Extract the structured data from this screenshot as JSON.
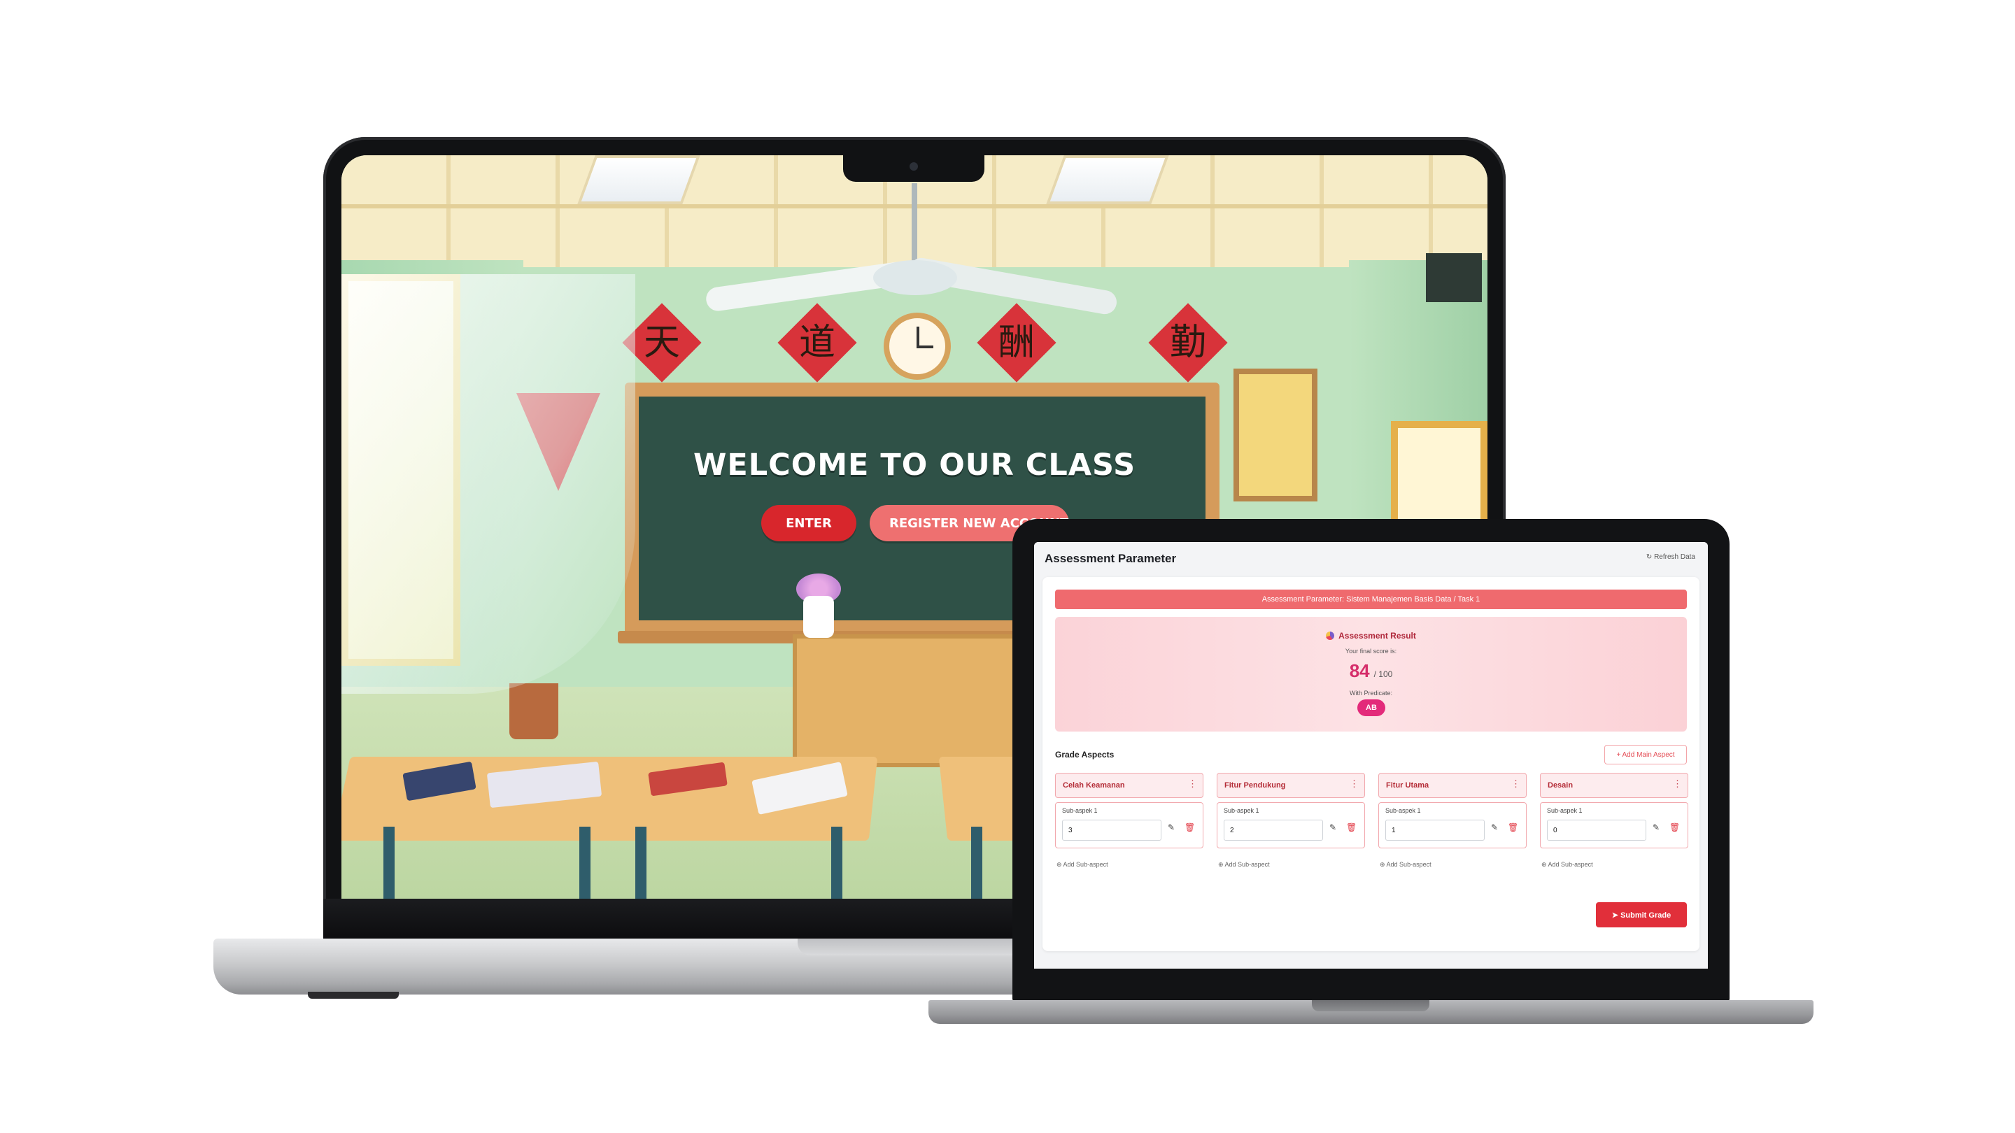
{
  "laptop_classroom": {
    "welcome_title": "WELCOME TO OUR CLASS",
    "enter_button": "ENTER",
    "register_button": "REGISTER NEW ACCOUNT",
    "chinese_chars": [
      "天",
      "道",
      "酬",
      "勤"
    ],
    "colors": {
      "enter": "#d8262c",
      "register": "#ee7070",
      "chalkboard": "#2f5147"
    }
  },
  "laptop_assessment": {
    "header": {
      "title": "Assessment Parameter",
      "refresh_label": "↻ Refresh Data"
    },
    "banner": "Assessment Parameter: Sistem Manajemen Basis Data / Task 1",
    "result": {
      "title": "Assessment Result",
      "subtitle": "Your final score is:",
      "score": "84",
      "score_max": "/ 100",
      "predicate_label": "With Predicate:",
      "predicate": "AB"
    },
    "grade_aspects": {
      "title": "Grade Aspects",
      "add_main_label": "+ Add Main Aspect",
      "aspects": [
        {
          "name": "Celah Keamanan",
          "sub_label": "Sub-aspek 1",
          "value": "3",
          "add_sub": "⊕ Add Sub-aspect"
        },
        {
          "name": "Fitur Pendukung",
          "sub_label": "Sub-aspek 1",
          "value": "2",
          "add_sub": "⊕ Add Sub-aspect"
        },
        {
          "name": "Fitur Utama",
          "sub_label": "Sub-aspek 1",
          "value": "1",
          "add_sub": "⊕ Add Sub-aspect"
        },
        {
          "name": "Desain",
          "sub_label": "Sub-aspek 1",
          "value": "0",
          "add_sub": "⊕ Add Sub-aspect"
        }
      ]
    },
    "submit_label": "➤ Submit Grade",
    "colors": {
      "accent": "#e12f3a",
      "banner": "#ef6a6e",
      "badge": "#e32a7a",
      "score": "#d52d6a"
    }
  }
}
